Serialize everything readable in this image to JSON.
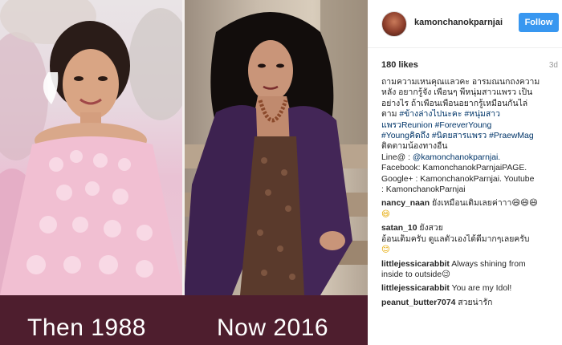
{
  "photo": {
    "caption_left": "Then 1988",
    "caption_right": "Now 2016"
  },
  "post": {
    "username": "kamonchanokparnjai",
    "follow_label": "Follow",
    "likes": "180 likes",
    "age": "3d",
    "caption_lines": [
      "ถามความเหนคุณแลวคะ อารมณนกถงความ",
      "หลัง อยากรู้จัง เพื่อนๆ พี่หนุ่มสาวแพรว เป็น",
      "อย่างไร ถ้าเพื่อนเพื่อนอยากรู้เหมือนกันไล่"
    ],
    "caption_line4_text": "ตาม",
    "caption_tag1": "#ข้างล่างไปนะคะ",
    "caption_tag2": "#หนุ่มสาว",
    "caption_tag3": "แพรวReunion",
    "caption_tag4": "#ForeverYoung",
    "caption_tag5": "#Youngคิดถึง",
    "caption_tag6": "#นิตยสารแพรว",
    "caption_tag7": "#PraewMag",
    "caption_after_tags": "ติดตามน้องทางอื่น",
    "contact_line1_prefix": "Line@ :",
    "contact_line1_handle": "@kamonchanokparnjai.",
    "contact_line2": "Facebook: KamonchanokParnjaiPAGE.",
    "contact_line3": "Google+ : KamonchanokParnjai. Youtube",
    "contact_line4": ": KamonchanokParnjai"
  },
  "comments": [
    {
      "user": "nancy_naan",
      "text": "ยังเหมือนเดิมเลยค่าาา😄😄😄",
      "text2": "😄"
    },
    {
      "user": "satan_10",
      "text": "อ้อนเต็มครับ ดูแลตัวเองได้ดีมากๆเลยครับ",
      "text_head": "ยังสวย",
      "text2": "😊"
    },
    {
      "user": "littlejessicarabbit",
      "text": "Always shining from",
      "text2": "inside to outside😉"
    },
    {
      "user": "littlejessicarabbit",
      "text": "You are my Idol!"
    },
    {
      "user": "peanut_butter7074",
      "text": "สวยน่ารัก"
    }
  ],
  "colors": {
    "follow_bg": "#3897f0",
    "caption_bar": "#4e1e2e",
    "hashtag": "#003569"
  },
  "icons": [
    "avatar"
  ]
}
